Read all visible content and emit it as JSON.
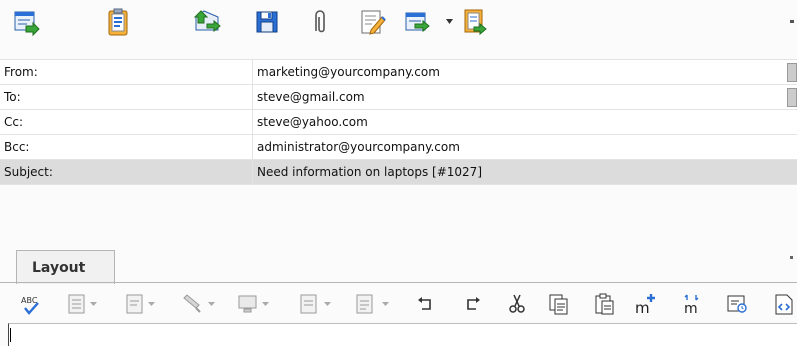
{
  "toolbar": {
    "icons": [
      "send-icon",
      "clipboard-task-icon",
      "send-receive-icon",
      "save-icon",
      "attach-icon",
      "compose-note-icon",
      "forward-icon",
      "document-action-icon"
    ]
  },
  "fields": {
    "from": {
      "label": "From:",
      "value": "marketing@yourcompany.com"
    },
    "to": {
      "label": "To:",
      "value": "steve@gmail.com"
    },
    "cc": {
      "label": "Cc:",
      "value": "steve@yahoo.com"
    },
    "bcc": {
      "label": "Bcc:",
      "value": "administrator@yourcompany.com"
    },
    "subject": {
      "label": "Subject:",
      "value": "Need information on laptops [#1027]"
    }
  },
  "tabs": {
    "layout_label": "Layout"
  },
  "format_toolbar": {
    "icons": [
      "spellcheck-icon",
      "paragraph-style-icon",
      "font-style-icon",
      "highlight-icon",
      "insert-object-icon",
      "align-icon",
      "list-icon",
      "undo-icon",
      "redo-icon",
      "cut-icon",
      "copy-icon",
      "paste-icon",
      "insert-merge-field-icon",
      "merge-field-icon",
      "insert-image-icon",
      "view-source-icon"
    ]
  },
  "colors": {
    "selected_row": "#dcdcdc",
    "accent_green": "#3aa63a",
    "accent_blue": "#2a6fd6"
  }
}
